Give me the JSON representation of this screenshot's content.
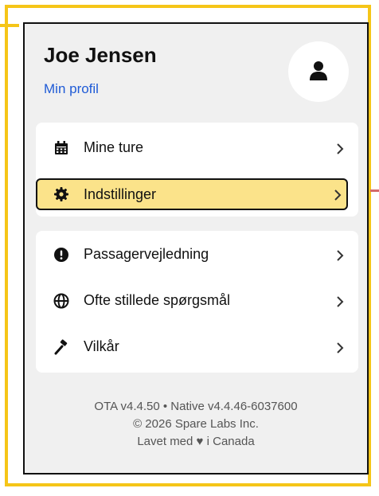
{
  "user": {
    "name": "Joe Jensen",
    "profile_link": "Min profil"
  },
  "menu_primary": [
    {
      "label": "Mine ture",
      "icon": "calendar-icon"
    },
    {
      "label": "Indstillinger",
      "icon": "gear-icon",
      "highlighted": true
    }
  ],
  "menu_secondary": [
    {
      "label": "Passagervejledning",
      "icon": "exclamation-circle-icon"
    },
    {
      "label": "Ofte stillede spørgsmål",
      "icon": "globe-icon"
    },
    {
      "label": "Vilkår",
      "icon": "gavel-icon"
    }
  ],
  "footer": {
    "version": "OTA v4.4.50 • Native v4.4.46-6037600",
    "copyright": "© 2026 Spare Labs Inc.",
    "made_in_prefix": "Lavet med",
    "made_in_suffix": "i Canada"
  },
  "colors": {
    "annotation_frame": "#f5c518",
    "highlight_fill": "#fbe38a",
    "link": "#1f5bd6",
    "connector": "#d46a6a"
  }
}
